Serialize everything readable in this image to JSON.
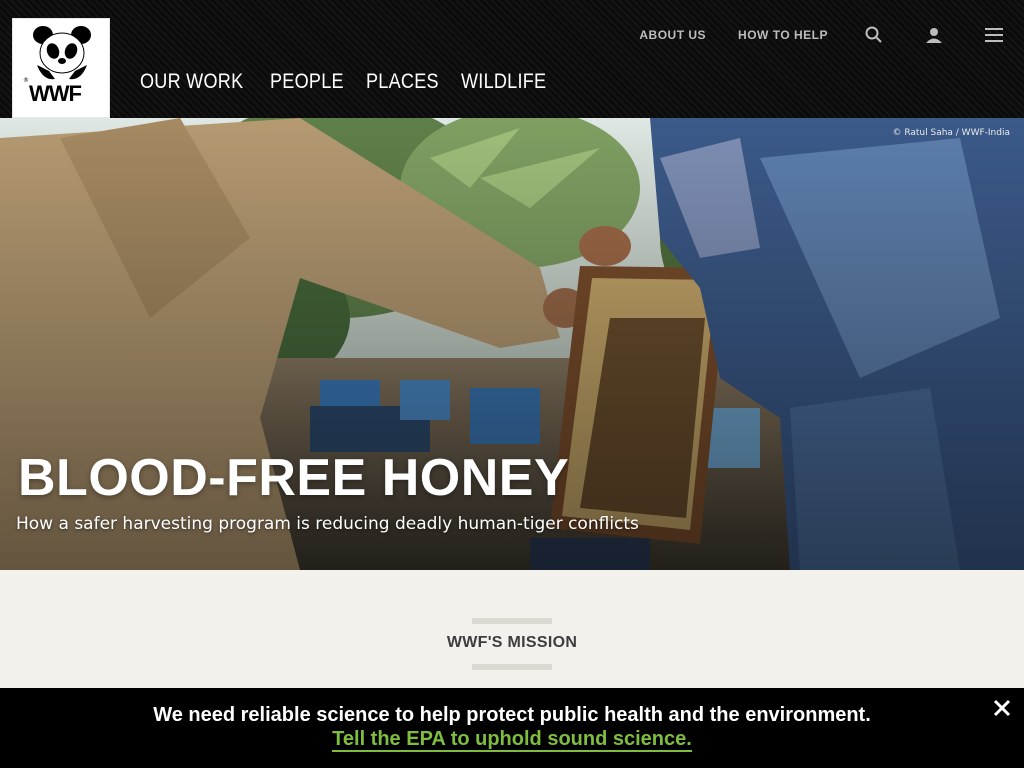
{
  "header": {
    "logo": {
      "alt": "WWF",
      "wordmark": "WWF"
    },
    "top_links": [
      "ABOUT US",
      "HOW TO HELP"
    ],
    "main_nav": [
      "OUR WORK",
      "PEOPLE",
      "PLACES",
      "WILDLIFE"
    ]
  },
  "hero": {
    "credit": "© Ratul Saha / WWF-India",
    "title": "BLOOD-FREE HONEY",
    "subtitle": "How a safer harvesting program is reducing deadly human-tiger conflicts"
  },
  "mission": {
    "title": "WWF'S MISSION"
  },
  "alert": {
    "message": "We need reliable science to help protect public health and the environment.",
    "link": "Tell the EPA to uphold sound science."
  },
  "colors": {
    "alert_link": "#7fbd3e",
    "header_bg": "#0b0b0b",
    "page_bg": "#f3f1ec"
  }
}
